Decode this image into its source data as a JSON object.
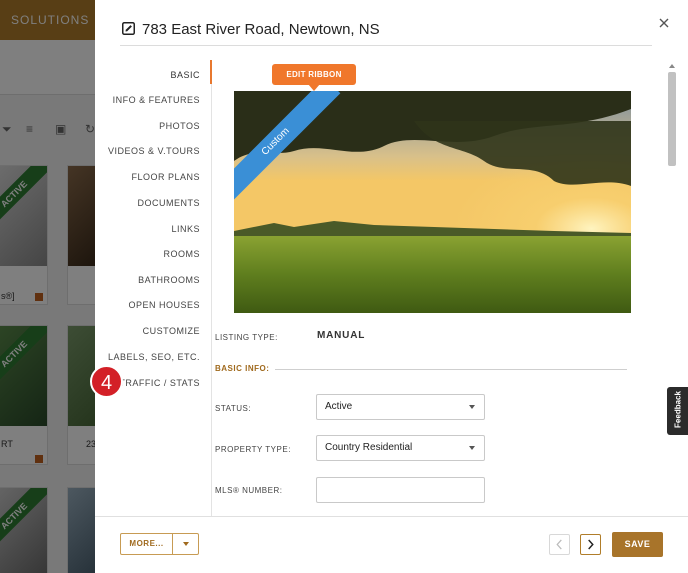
{
  "background": {
    "solutions_label": "SOLUTIONS",
    "status_ribbon": "ACTIVE",
    "card_text_1": "s®]",
    "card_text_2": "RT",
    "card_text_3": "23"
  },
  "modal": {
    "title": "783 East River Road, Newtown, NS",
    "close_icon": "close-icon",
    "edit_icon": "edit-icon"
  },
  "nav": {
    "items": [
      {
        "label": "BASIC",
        "active": true
      },
      {
        "label": "INFO & FEATURES"
      },
      {
        "label": "PHOTOS"
      },
      {
        "label": "VIDEOS & V.TOURS"
      },
      {
        "label": "FLOOR PLANS"
      },
      {
        "label": "DOCUMENTS"
      },
      {
        "label": "LINKS"
      },
      {
        "label": "ROOMS"
      },
      {
        "label": "BATHROOMS"
      },
      {
        "label": "OPEN HOUSES"
      },
      {
        "label": "CUSTOMIZE"
      },
      {
        "label": "LABELS, SEO, ETC."
      },
      {
        "label": "TRAFFIC / STATS"
      }
    ],
    "step_badge": "4"
  },
  "content": {
    "edit_ribbon_label": "EDIT RIBBON",
    "photo_ribbon_label": "Custom",
    "listing_type_label": "LISTING TYPE:",
    "listing_type_value": "MANUAL",
    "basic_info_label": "BASIC INFO:",
    "status_label": "STATUS:",
    "status_value": "Active",
    "property_type_label": "PROPERTY TYPE:",
    "property_type_value": "Country Residential",
    "mls_label": "MLS® NUMBER:",
    "mls_value": ""
  },
  "footer": {
    "more_label": "MORE...",
    "save_label": "SAVE"
  },
  "feedback_label": "Feedback",
  "colors": {
    "accent_gold": "#a8742a",
    "orange": "#f0772b",
    "ribbon_blue": "#3a8fd6",
    "active_green": "#2e7d32",
    "badge_red": "#d32027"
  }
}
